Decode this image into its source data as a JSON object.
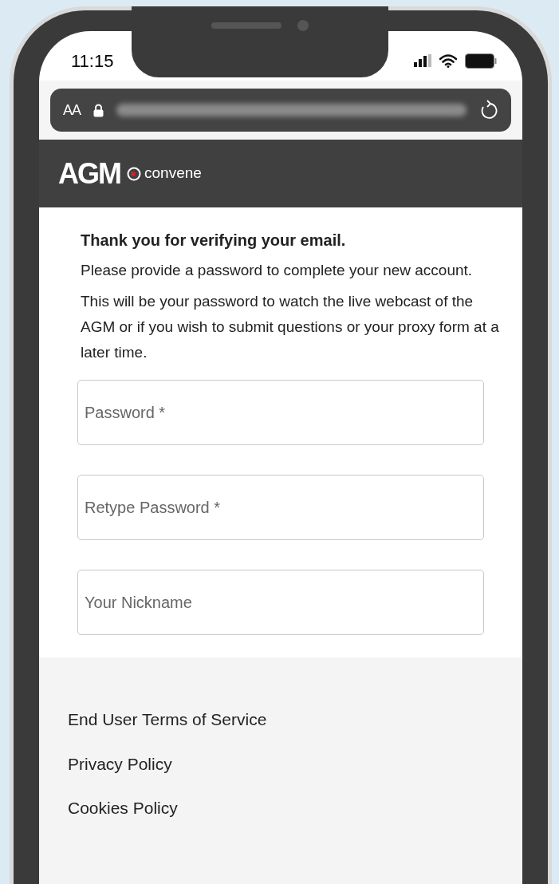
{
  "status_bar": {
    "time": "11:15"
  },
  "address_bar": {
    "text_size_button": "AA"
  },
  "header": {
    "logo": "AGM",
    "brand": "convene"
  },
  "content": {
    "heading": "Thank you for verifying your email.",
    "paragraphs": [
      "Please provide a password to complete your new account.",
      "This will be your password to watch the live webcast of the AGM or if you wish to submit questions or your proxy form at a later time."
    ],
    "fields": [
      {
        "placeholder": "Password *"
      },
      {
        "placeholder": "Retype Password *"
      },
      {
        "placeholder": "Your Nickname"
      }
    ]
  },
  "footer_links": [
    "End User Terms of Service",
    "Privacy Policy",
    "Cookies Policy"
  ]
}
